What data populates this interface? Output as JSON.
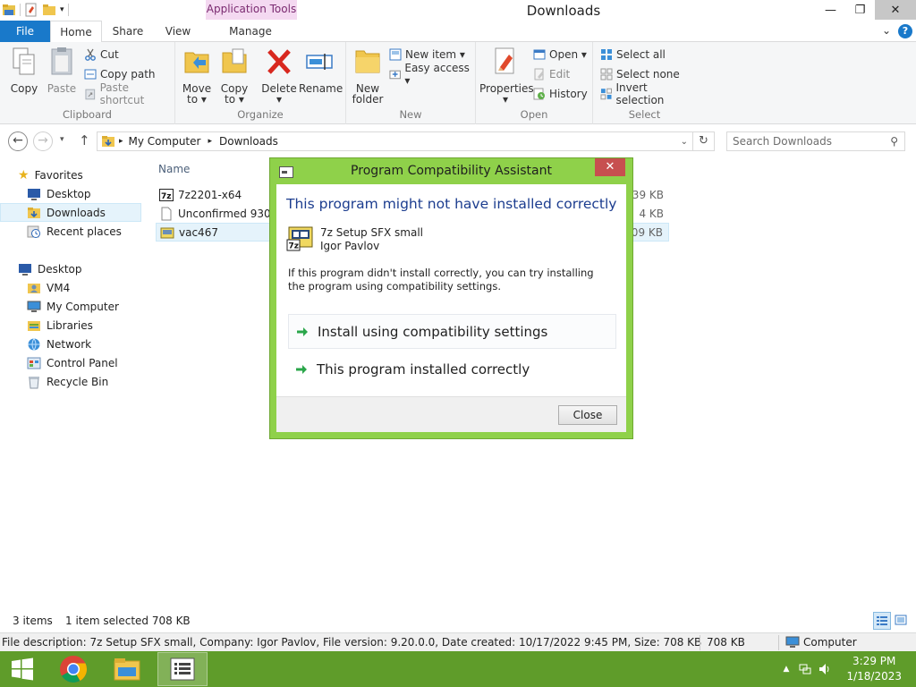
{
  "window": {
    "title": "Downloads",
    "context_tab": "Application Tools",
    "controls": {
      "minimize": "—",
      "maximize": "❐",
      "close": "✕"
    }
  },
  "tabs": {
    "file": "File",
    "home": "Home",
    "share": "Share",
    "view": "View",
    "manage": "Manage"
  },
  "help": {
    "chevron": "⌄",
    "q": "?"
  },
  "ribbon": {
    "clipboard": {
      "label": "Clipboard",
      "copy": "Copy",
      "paste": "Paste",
      "cut": "Cut",
      "copy_path": "Copy path",
      "paste_shortcut": "Paste shortcut"
    },
    "organize": {
      "label": "Organize",
      "move_to_1": "Move",
      "move_to_2": "to ▾",
      "copy_to_1": "Copy",
      "copy_to_2": "to ▾",
      "delete_1": "Delete",
      "delete_2": "▾",
      "rename": "Rename"
    },
    "new": {
      "label": "New",
      "new_folder_1": "New",
      "new_folder_2": "folder",
      "new_item": "New item ▾",
      "easy_access": "Easy access ▾"
    },
    "open": {
      "label": "Open",
      "properties_1": "Properties",
      "properties_2": "▾",
      "open": "Open ▾",
      "edit": "Edit",
      "history": "History"
    },
    "select": {
      "label": "Select",
      "select_all": "Select all",
      "select_none": "Select none",
      "invert_selection": "Invert selection"
    }
  },
  "address": {
    "path": [
      "My Computer",
      "Downloads"
    ],
    "search_placeholder": "Search Downloads"
  },
  "navpane": {
    "favorites": "Favorites",
    "fav_items": [
      "Desktop",
      "Downloads",
      "Recent places"
    ],
    "desktop": "Desktop",
    "desktop_items": [
      "VM4",
      "My Computer",
      "Libraries",
      "Network",
      "Control Panel",
      "Recycle Bin"
    ]
  },
  "filelist": {
    "column_name": "Name",
    "files": [
      {
        "name": "7z2201-x64",
        "size": "539 KB"
      },
      {
        "name": "Unconfirmed 93055",
        "size": "4 KB"
      },
      {
        "name": "vac467",
        "size": "709 KB"
      }
    ]
  },
  "status": {
    "items": "3 items",
    "selected": "1 item selected  708 KB"
  },
  "infobar": {
    "description": "File description: 7z Setup SFX small, Company: Igor Pavlov, File version: 9.20.0.0, Date created: 10/17/2022 9:45 PM, Size: 708 KB",
    "size": "708 KB",
    "location": "Computer"
  },
  "taskbar": {
    "time": "3:29 PM",
    "date": "1/18/2023"
  },
  "dialog": {
    "title": "Program Compatibility Assistant",
    "close": "✕",
    "heading": "This program might not have installed correctly",
    "program_name": "7z Setup SFX small",
    "publisher": "Igor Pavlov",
    "message": "If this program didn't install correctly, you can try installing the program using compatibility settings.",
    "option_1": "Install using compatibility settings",
    "option_2": "This program installed correctly",
    "close_button": "Close"
  },
  "colors": {
    "dialog_frame": "#8fd14a",
    "taskbar": "#5f9c2a",
    "file_tab": "#1979ca",
    "heading_blue": "#1c3d8f",
    "arrow_green": "#2aa64a"
  }
}
